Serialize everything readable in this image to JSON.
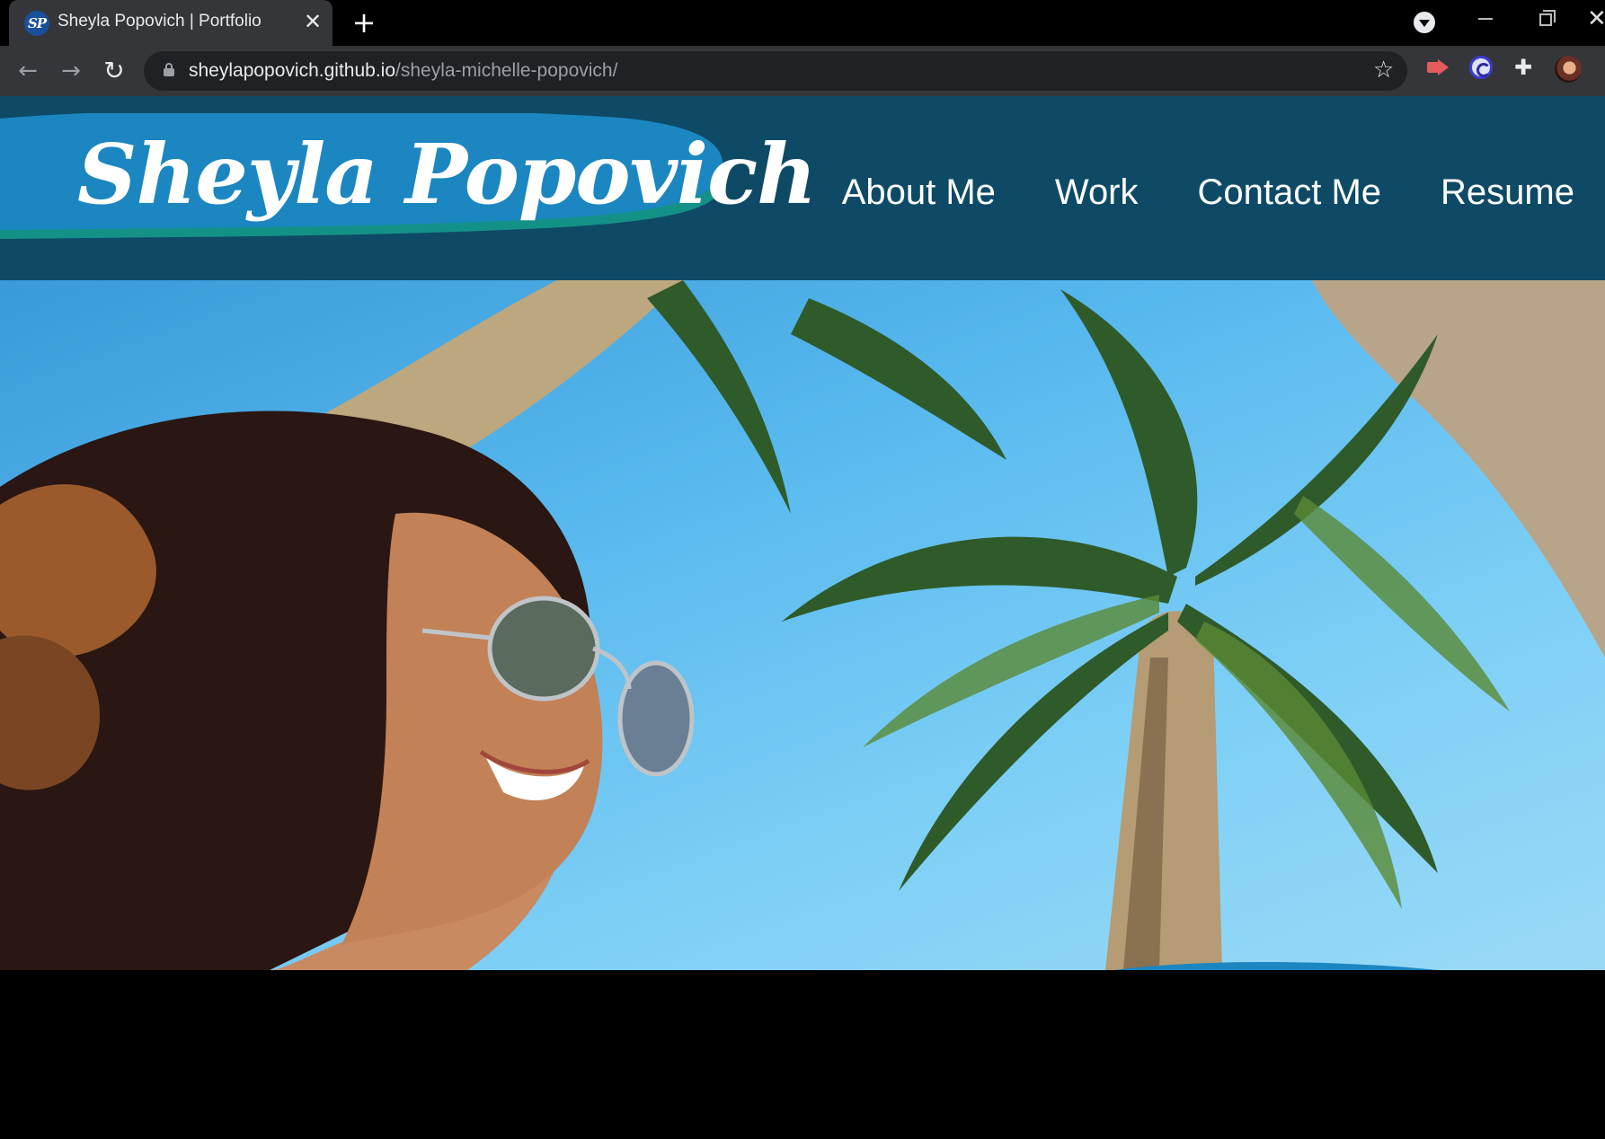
{
  "browser": {
    "tab_title": "Sheyla Popovich | Portfolio",
    "favicon_text": "SP",
    "url_host": "sheylapopovich.github.io",
    "url_path": "/sheyla-michelle-popovich/"
  },
  "site": {
    "logo_text": "Sheyla Popovich",
    "nav": [
      {
        "label": "About Me"
      },
      {
        "label": "Work"
      },
      {
        "label": "Contact Me"
      },
      {
        "label": "Resume"
      }
    ]
  },
  "colors": {
    "header_bg": "#0e4a66",
    "logo_blue": "#1b86c0",
    "logo_teal": "#149187"
  },
  "hero": {
    "image": "hero-photo-woman-sunglasses-palm-trees"
  }
}
